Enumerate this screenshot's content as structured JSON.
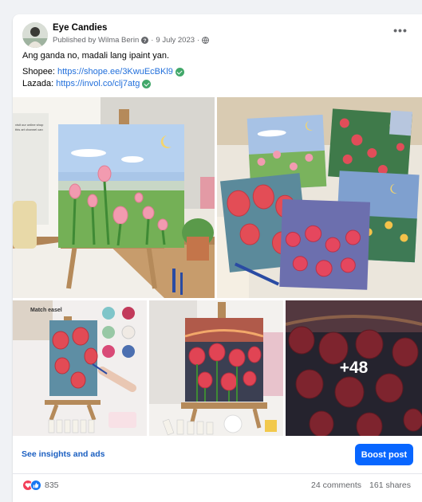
{
  "post": {
    "page_name": "Eye Candies",
    "published_by": "Published by Wilma Berin",
    "date": "9 July 2023",
    "more_label": "•••",
    "caption": "Ang ganda no, madali lang ipaint yan.",
    "shopee_label": "Shopee:",
    "shopee_link": "https://shope.ee/3KwuEcBKl9",
    "lazada_label": "Lazada:",
    "lazada_link": "https://invol.co/clj7atg",
    "more_photos": "+48"
  },
  "actions": {
    "insights_label": "See insights and ads",
    "boost_label": "Boost post"
  },
  "stats": {
    "reaction_count": "835",
    "comments": "24 comments",
    "shares": "161 shares"
  },
  "photo_text": {
    "match_easel": "Match easel",
    "thank_you": "THANK YOU"
  },
  "colors": {
    "link": "#216fdb",
    "boost": "#0866ff",
    "verified": "#42a86a",
    "like": "#1877f2",
    "love": "#f33e58"
  }
}
